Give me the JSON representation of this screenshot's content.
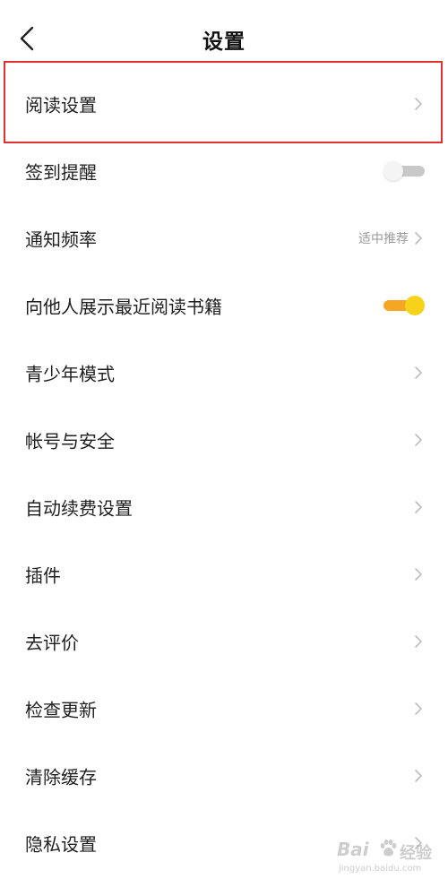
{
  "header": {
    "title": "设置",
    "back_icon": "chevron-left-icon"
  },
  "settings": [
    {
      "label": "阅读设置",
      "control": "chevron"
    },
    {
      "label": "签到提醒",
      "control": "toggle",
      "enabled": false
    },
    {
      "label": "通知频率",
      "control": "chevron",
      "value": "适中推荐"
    },
    {
      "label": "向他人展示最近阅读书籍",
      "control": "toggle",
      "enabled": true
    },
    {
      "label": "青少年模式",
      "control": "chevron"
    },
    {
      "label": "帐号与安全",
      "control": "chevron"
    },
    {
      "label": "自动续费设置",
      "control": "chevron"
    },
    {
      "label": "插件",
      "control": "chevron"
    },
    {
      "label": "去评价",
      "control": "chevron"
    },
    {
      "label": "检查更新",
      "control": "chevron"
    },
    {
      "label": "清除缓存",
      "control": "chevron"
    },
    {
      "label": "隐私设置",
      "control": "chevron"
    }
  ],
  "colors": {
    "highlight_border": "#e0302f",
    "toggle_on_track": "#f5a623",
    "toggle_on_knob": "#f7d21b",
    "toggle_off_track": "#c8c8c8",
    "chevron": "#bdbdbd",
    "secondary_text": "#9a9a9a"
  },
  "watermark": {
    "brand": "Bai",
    "suffix": "经验",
    "url": "jingyan.baidu.com"
  }
}
